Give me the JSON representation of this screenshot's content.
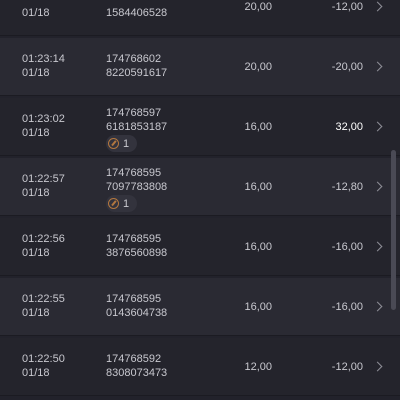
{
  "rows": [
    {
      "time": "",
      "date": "01/18",
      "id_line1": "",
      "id_line2": "1584406528",
      "amount": "20,00",
      "result": "-12,00",
      "result_positive": false,
      "badge": null
    },
    {
      "time": "01:23:14",
      "date": "01/18",
      "id_line1": "174768602",
      "id_line2": "8220591617",
      "amount": "20,00",
      "result": "-20,00",
      "result_positive": false,
      "badge": null
    },
    {
      "time": "01:23:02",
      "date": "01/18",
      "id_line1": "174768597",
      "id_line2": "6181853187",
      "amount": "16,00",
      "result": "32,00",
      "result_positive": true,
      "badge": {
        "count": "1"
      }
    },
    {
      "time": "01:22:57",
      "date": "01/18",
      "id_line1": "174768595",
      "id_line2": "7097783808",
      "amount": "16,00",
      "result": "-12,80",
      "result_positive": false,
      "badge": {
        "count": "1"
      }
    },
    {
      "time": "01:22:56",
      "date": "01/18",
      "id_line1": "174768595",
      "id_line2": "3876560898",
      "amount": "16,00",
      "result": "-16,00",
      "result_positive": false,
      "badge": null
    },
    {
      "time": "01:22:55",
      "date": "01/18",
      "id_line1": "174768595",
      "id_line2": "0143604738",
      "amount": "16,00",
      "result": "-16,00",
      "result_positive": false,
      "badge": null
    },
    {
      "time": "01:22:50",
      "date": "01/18",
      "id_line1": "174768592",
      "id_line2": "8308073473",
      "amount": "12,00",
      "result": "-12,00",
      "result_positive": false,
      "badge": null
    }
  ],
  "icons": {
    "chevron": "chevron-right-icon",
    "badge": "free-spin-icon"
  },
  "colors": {
    "background": "#22222b",
    "row_even": "#2a2a33",
    "row_odd": "#24242c",
    "text": "#c8c8cf",
    "positive_result": "#ffffff",
    "badge_icon": "#b3773f"
  }
}
